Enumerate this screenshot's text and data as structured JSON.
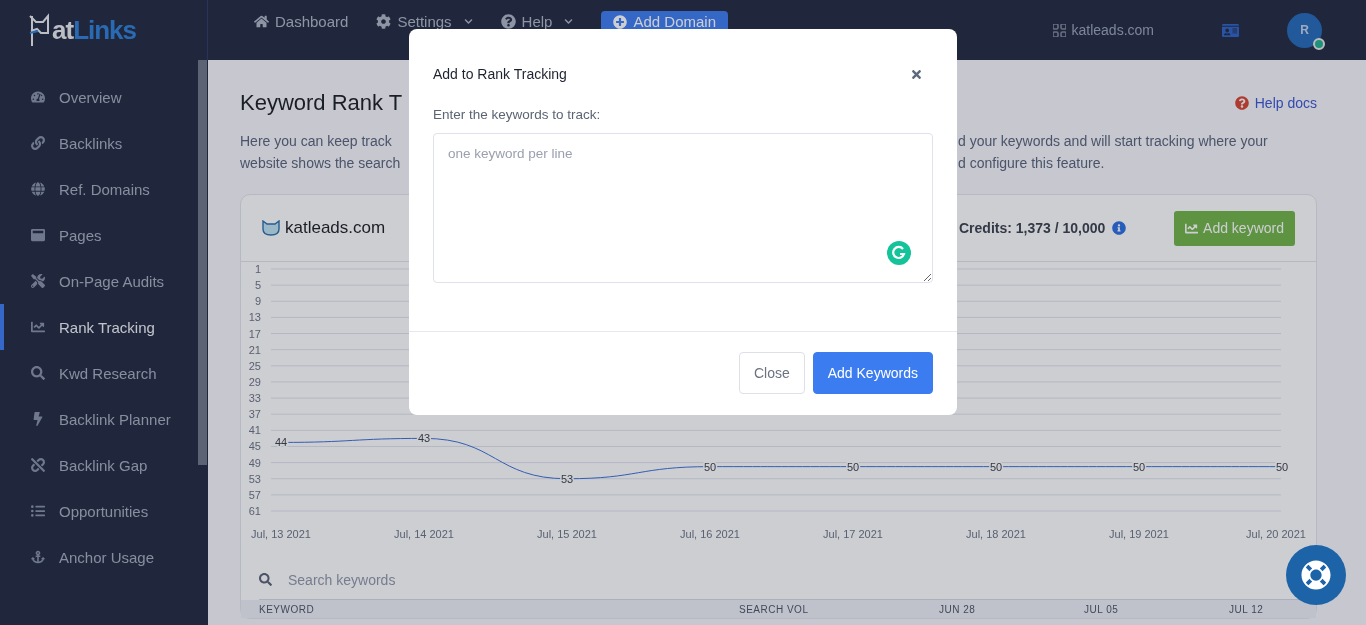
{
  "topbar": {
    "logo": {
      "text_1": "at",
      "text_2": "Links"
    },
    "nav": [
      {
        "label": "Dashboard",
        "dropdown": false
      },
      {
        "label": "Settings",
        "dropdown": true
      },
      {
        "label": "Help",
        "dropdown": true
      }
    ],
    "add_domain": "Add Domain",
    "domain": "katleads.com",
    "avatar": "R",
    "online": true
  },
  "sidebar": {
    "items": [
      {
        "label": "Overview",
        "selected": false
      },
      {
        "label": "Backlinks",
        "selected": false
      },
      {
        "label": "Ref. Domains",
        "selected": false
      },
      {
        "label": "Pages",
        "selected": false
      },
      {
        "label": "On-Page Audits",
        "selected": false
      },
      {
        "label": "Rank Tracking",
        "selected": true
      },
      {
        "label": "Kwd Research",
        "selected": false
      },
      {
        "label": "Backlink Planner",
        "selected": false
      },
      {
        "label": "Backlink Gap",
        "selected": false
      },
      {
        "label": "Opportunities",
        "selected": false
      },
      {
        "label": "Anchor Usage",
        "selected": false
      }
    ]
  },
  "page": {
    "title": "Keyword Rank T",
    "help": "Help docs",
    "description_left": [
      "Here you can keep track",
      "website shows the search"
    ],
    "description_right": [
      "d your keywords and will start tracking where your",
      "d configure this feature."
    ]
  },
  "card": {
    "site": "katleads.com",
    "credits": "Credits: 1,373 / 10,000",
    "add_button": "Add keyword",
    "chart_data": {
      "type": "line",
      "categories": [
        "Jul, 13 2021",
        "Jul, 14 2021",
        "Jul, 15 2021",
        "Jul, 16 2021",
        "Jul, 17 2021",
        "Jul, 18 2021",
        "Jul, 19 2021",
        "Jul, 20 2021"
      ],
      "series": [
        {
          "color": "#3b6fd8",
          "values": [
            44,
            43,
            53,
            50,
            50,
            50,
            50,
            50
          ]
        }
      ],
      "ylim": [
        61,
        1
      ],
      "grid": true,
      "yticks": [
        1,
        5,
        9,
        13,
        17,
        21,
        25,
        29,
        33,
        37,
        41,
        45,
        49,
        53,
        57,
        61
      ],
      "data_labels": true
    },
    "search_placeholder": "Search keywords",
    "columns": [
      "KEYWORD",
      "SEARCH VOL",
      "JUN 28",
      "JUL 05",
      "JUL 12"
    ]
  },
  "modal": {
    "title": "Add to Rank Tracking",
    "label": "Enter the keywords to track:",
    "placeholder": "one keyword per line",
    "buttons": [
      {
        "label": "Close",
        "kind": "secondary"
      },
      {
        "label": "Add Keywords",
        "kind": "primary"
      }
    ]
  }
}
